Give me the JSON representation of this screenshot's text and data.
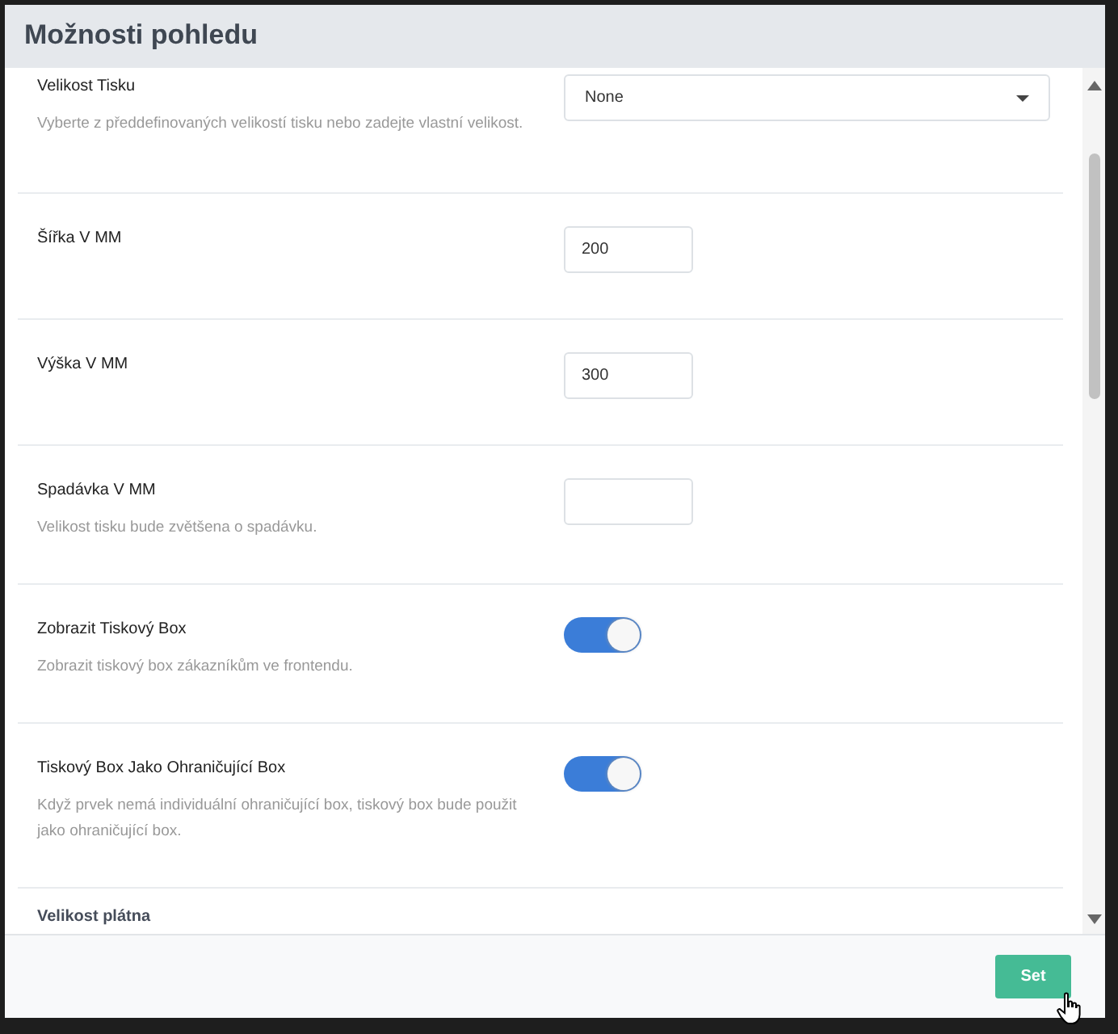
{
  "dialog": {
    "title": "Možnosti pohledu"
  },
  "rows": [
    {
      "kind": "select",
      "label": "Velikost Tisku",
      "description": "Vyberte z předdefinovaných velikostí tisku nebo zadejte vlastní velikost.",
      "value": "None"
    },
    {
      "kind": "input",
      "label": "Šířka V MM",
      "value": "200"
    },
    {
      "kind": "input",
      "label": "Výška V MM",
      "value": "300"
    },
    {
      "kind": "input",
      "label": "Spadávka V MM",
      "description": "Velikost tisku bude zvětšena o spadávku."
    },
    {
      "kind": "toggle",
      "label": "Zobrazit Tiskový Box",
      "description": "Zobrazit tiskový box zákazníkům ve frontendu.",
      "on": true
    },
    {
      "kind": "toggle",
      "label": "Tiskový Box Jako Ohraničující Box",
      "description": "Když prvek nemá individuální ohraničující box, tiskový box bude použit jako ohraničující box.",
      "on": true
    },
    {
      "kind": "heading",
      "label": "Velikost plátna"
    }
  ],
  "buttons": [
    "Set"
  ]
}
